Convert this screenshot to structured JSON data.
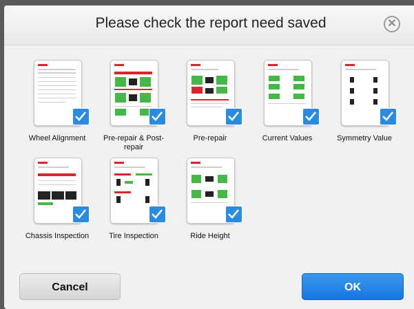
{
  "dialog": {
    "title": "Please check the report need saved",
    "close_icon": "close-circle-icon"
  },
  "reports": [
    {
      "label": "Wheel Alignment",
      "checked": true
    },
    {
      "label": "Pre-repair & Post-repair",
      "checked": true
    },
    {
      "label": "Pre-repair",
      "checked": true
    },
    {
      "label": "Current Values",
      "checked": true
    },
    {
      "label": "Symmetry Value",
      "checked": true
    },
    {
      "label": "Chassis Inspection",
      "checked": true
    },
    {
      "label": "Tire Inspection",
      "checked": true
    },
    {
      "label": "Ride Height",
      "checked": true
    }
  ],
  "buttons": {
    "cancel": "Cancel",
    "ok": "OK"
  },
  "colors": {
    "accent": "#2a8be0",
    "check": "#2a8be0",
    "red": "#d9252b",
    "green": "#45b64a"
  }
}
